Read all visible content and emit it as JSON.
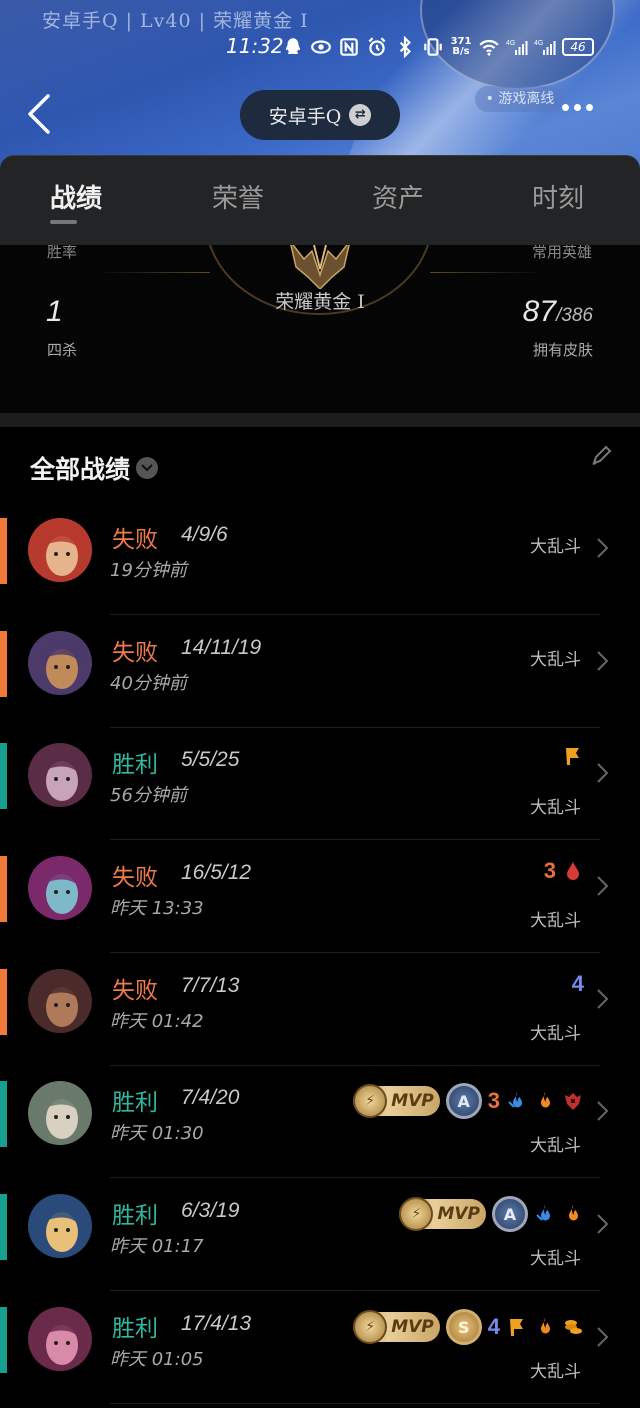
{
  "header": {
    "profile_line": "安卓手Q | Lv40 | 荣耀黄金 I",
    "status_time": "11:32",
    "net_speed_top": "371",
    "net_speed_bottom": "B/s",
    "battery": "46",
    "online_status": "• 游戏离线",
    "account_name": "安卓手Q",
    "icons": [
      "qq-icon",
      "eye-icon",
      "nfc-icon",
      "alarm-icon",
      "bluetooth-icon",
      "vibrate-icon",
      "wifi-icon",
      "signal-4g-icon",
      "signal-4g-icon",
      "battery-icon"
    ]
  },
  "tabs": [
    {
      "label": "战绩",
      "active": true
    },
    {
      "label": "荣誉",
      "active": false
    },
    {
      "label": "资产",
      "active": false
    },
    {
      "label": "时刻",
      "active": false
    }
  ],
  "summary": {
    "rank_name": "荣耀黄金 I",
    "cut_label_left": "胜率",
    "cut_label_right": "常用英雄",
    "left_value": "1",
    "left_label": "四杀",
    "right_value": "87",
    "right_total": "/386",
    "right_label": "拥有皮肤"
  },
  "section_title": "全部战绩",
  "matches": [
    {
      "result": "失败",
      "kda": "4/9/6",
      "time": "19分钟前",
      "mode": "大乱斗",
      "win": false,
      "badges": []
    },
    {
      "result": "失败",
      "kda": "14/11/19",
      "time": "40分钟前",
      "mode": "大乱斗",
      "win": false,
      "badges": []
    },
    {
      "result": "胜利",
      "kda": "5/5/25",
      "time": "56分钟前",
      "mode": "大乱斗",
      "win": true,
      "badges": [
        "flag-icon"
      ]
    },
    {
      "result": "失败",
      "kda": "16/5/12",
      "time": "昨天 13:33",
      "mode": "大乱斗",
      "win": false,
      "badges": [
        "3",
        "blood-drop-icon"
      ]
    },
    {
      "result": "失败",
      "kda": "7/7/13",
      "time": "昨天 01:42",
      "mode": "大乱斗",
      "win": false,
      "badges": [
        "4"
      ]
    },
    {
      "result": "胜利",
      "kda": "7/4/20",
      "time": "昨天 01:30",
      "mode": "大乱斗",
      "win": true,
      "badges": [
        "MVP",
        "A",
        "3",
        "flame-blue-icon",
        "flame-orange-icon",
        "tower-icon"
      ]
    },
    {
      "result": "胜利",
      "kda": "6/3/19",
      "time": "昨天 01:17",
      "mode": "大乱斗",
      "win": true,
      "badges": [
        "MVP",
        "A",
        "flame-blue-icon",
        "flame-orange-icon"
      ]
    },
    {
      "result": "胜利",
      "kda": "17/4/13",
      "time": "昨天 01:05",
      "mode": "大乱斗",
      "win": true,
      "badges": [
        "MVP",
        "S",
        "4",
        "flag-icon",
        "flame-orange-icon",
        "coins-icon"
      ]
    }
  ],
  "mvp_label": "MVP",
  "colors": {
    "loss": "#f07a4a",
    "win": "#2fb8a0",
    "loss_bar": "#f07a3a",
    "win_bar": "#17a08f",
    "tab_bg": "#232426"
  }
}
